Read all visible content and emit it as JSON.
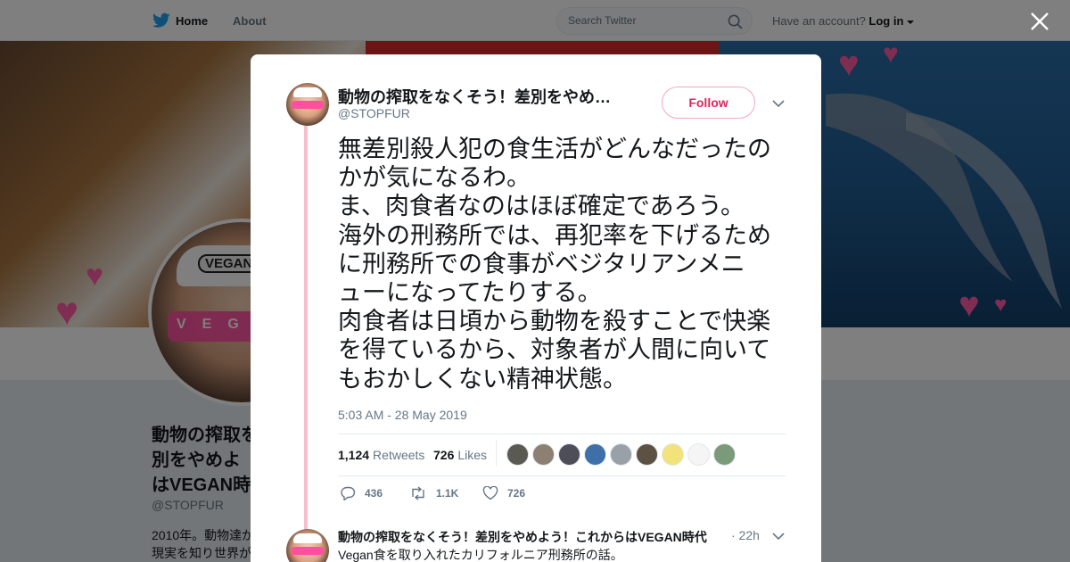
{
  "nav": {
    "home_label": "Home",
    "about_label": "About",
    "search_placeholder": "Search Twitter",
    "account_question": "Have an account?",
    "login_label": "Log in"
  },
  "profile": {
    "name": "動物の搾取をなくそう！差別をやめよう！これからはVEGAN時代",
    "name_visible": "動物の搾取を\n別をやめよ\nはVEGAN時",
    "handle": "@STOPFUR",
    "bio_visible": "2010年。動物達が\n現実を知り世界が",
    "avatar_cap_text": "VEGAN",
    "avatar_glasses_text": "VEGAN"
  },
  "tweet": {
    "author_name": "動物の搾取をなくそう！差別をやめ…",
    "author_handle": "@STOPFUR",
    "follow_label": "Follow",
    "text": "無差別殺人犯の食生活がどんなだったの\nかが気になるわ。\nま、肉食者なのはほぼ確定であろう。\n海外の刑務所では、再犯率を下げるため\nに刑務所での食事がベジタリアンメニ\nューになってたりする。\n肉食者は日頃から動物を殺すことで快楽\nを得ているから、対象者が人間に向いて\nもおかしくない精神状態。",
    "timestamp": "5:03 AM - 28 May 2019",
    "retweets_count": "1,124",
    "retweets_label": "Retweets",
    "likes_count": "726",
    "likes_label": "Likes",
    "reply_count": "436",
    "retweet_action_count": "1.1K",
    "like_action_count": "726"
  },
  "likers": [
    {
      "color": "#5a5a52"
    },
    {
      "color": "#8d7f72"
    },
    {
      "color": "#4e4e58"
    },
    {
      "color": "#3f6fa8"
    },
    {
      "color": "#9aa0a8"
    },
    {
      "color": "#5c5142"
    },
    {
      "color": "#f2e27a"
    },
    {
      "color": "#f5f5f5"
    },
    {
      "color": "#7a9a7a"
    }
  ],
  "reply": {
    "author_name": "動物の搾取をなくそう！差別をやめよう！これからはVEGAN時代",
    "time": "· 22h",
    "text": "Vegan食を取り入れたカリフォルニア刑務所の話。"
  },
  "colors": {
    "twitter_blue": "#1da1f2",
    "like_pink": "#e0245e",
    "thread_line": "#f7c0ce"
  },
  "icons": [
    "twitter-bird-icon",
    "search-icon",
    "dropdown-caret-icon",
    "close-icon",
    "chevron-down-icon",
    "reply-icon",
    "retweet-icon",
    "heart-icon"
  ]
}
